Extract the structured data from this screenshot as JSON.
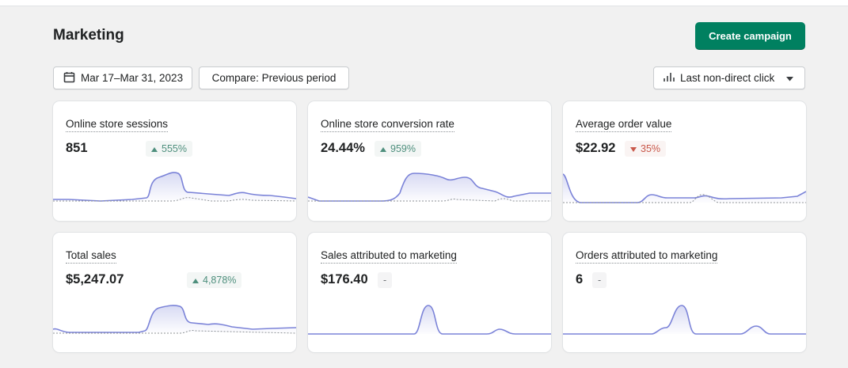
{
  "header": {
    "title": "Marketing",
    "primary_action": "Create campaign"
  },
  "filters": {
    "date_range": "Mar 17–Mar 31, 2023",
    "compare": "Compare: Previous period",
    "attribution": "Last non-direct click"
  },
  "colors": {
    "primary": "#008060",
    "positive": "#4e8f7d",
    "negative": "#c9584a",
    "series": "#7b83d8"
  },
  "metrics": [
    {
      "title": "Online store sessions",
      "value": "851",
      "change": "555%",
      "trend": "up"
    },
    {
      "title": "Online store conversion rate",
      "value": "24.44%",
      "change": "959%",
      "trend": "up"
    },
    {
      "title": "Average order value",
      "value": "$22.92",
      "change": "35%",
      "trend": "down"
    },
    {
      "title": "Total sales",
      "value": "$5,247.07",
      "change": "4,878%",
      "trend": "up"
    },
    {
      "title": "Sales attributed to marketing",
      "value": "$176.40",
      "change": "-",
      "trend": "none"
    },
    {
      "title": "Orders attributed to marketing",
      "value": "6",
      "change": "-",
      "trend": "none"
    }
  ]
}
